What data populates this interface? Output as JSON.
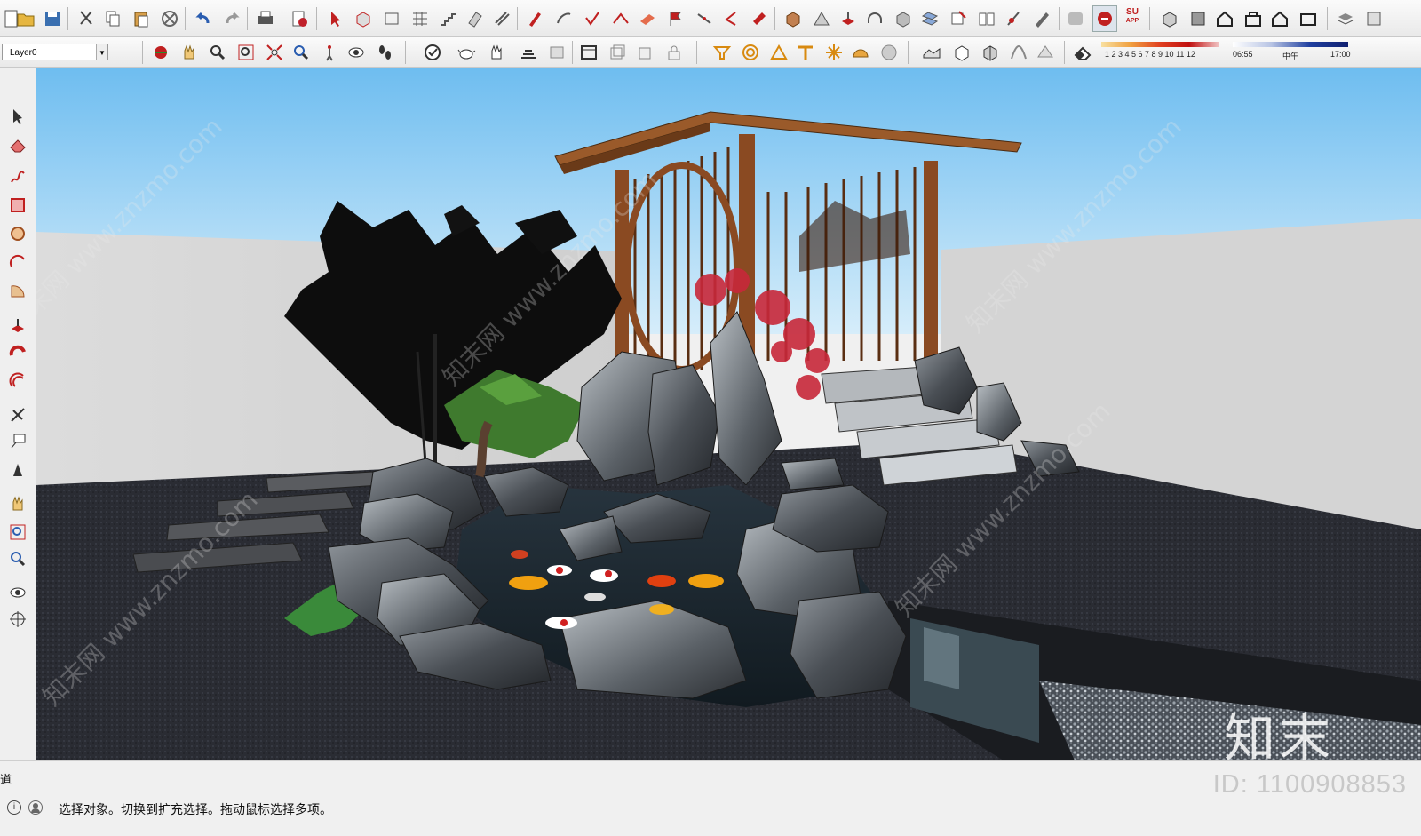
{
  "toolbar": {
    "layer_select": "Layer0",
    "shadow_scale_numbers": "1 2 3 4 5 6 7 8 9 10 11 12",
    "time_start": "06:55",
    "time_mid": "中午",
    "time_end": "17:00",
    "su_badge": "SU",
    "app_badge": "APP"
  },
  "status": {
    "prefix": "道",
    "message": "选择对象。切换到扩充选择。拖动鼠标选择多项。",
    "info_icon": "i"
  },
  "branding": {
    "id_label": "ID: 1100908853",
    "logo_text": "知末",
    "watermark": "知末网 www.znzmo.com"
  },
  "colors": {
    "sky_top": "#7cc3ef",
    "sky_bottom": "#cfe9f9",
    "wall": "#d9d9d9",
    "ground": "#2a2c33",
    "pavilion": "#8a4a22",
    "water": "#1d2a33"
  }
}
